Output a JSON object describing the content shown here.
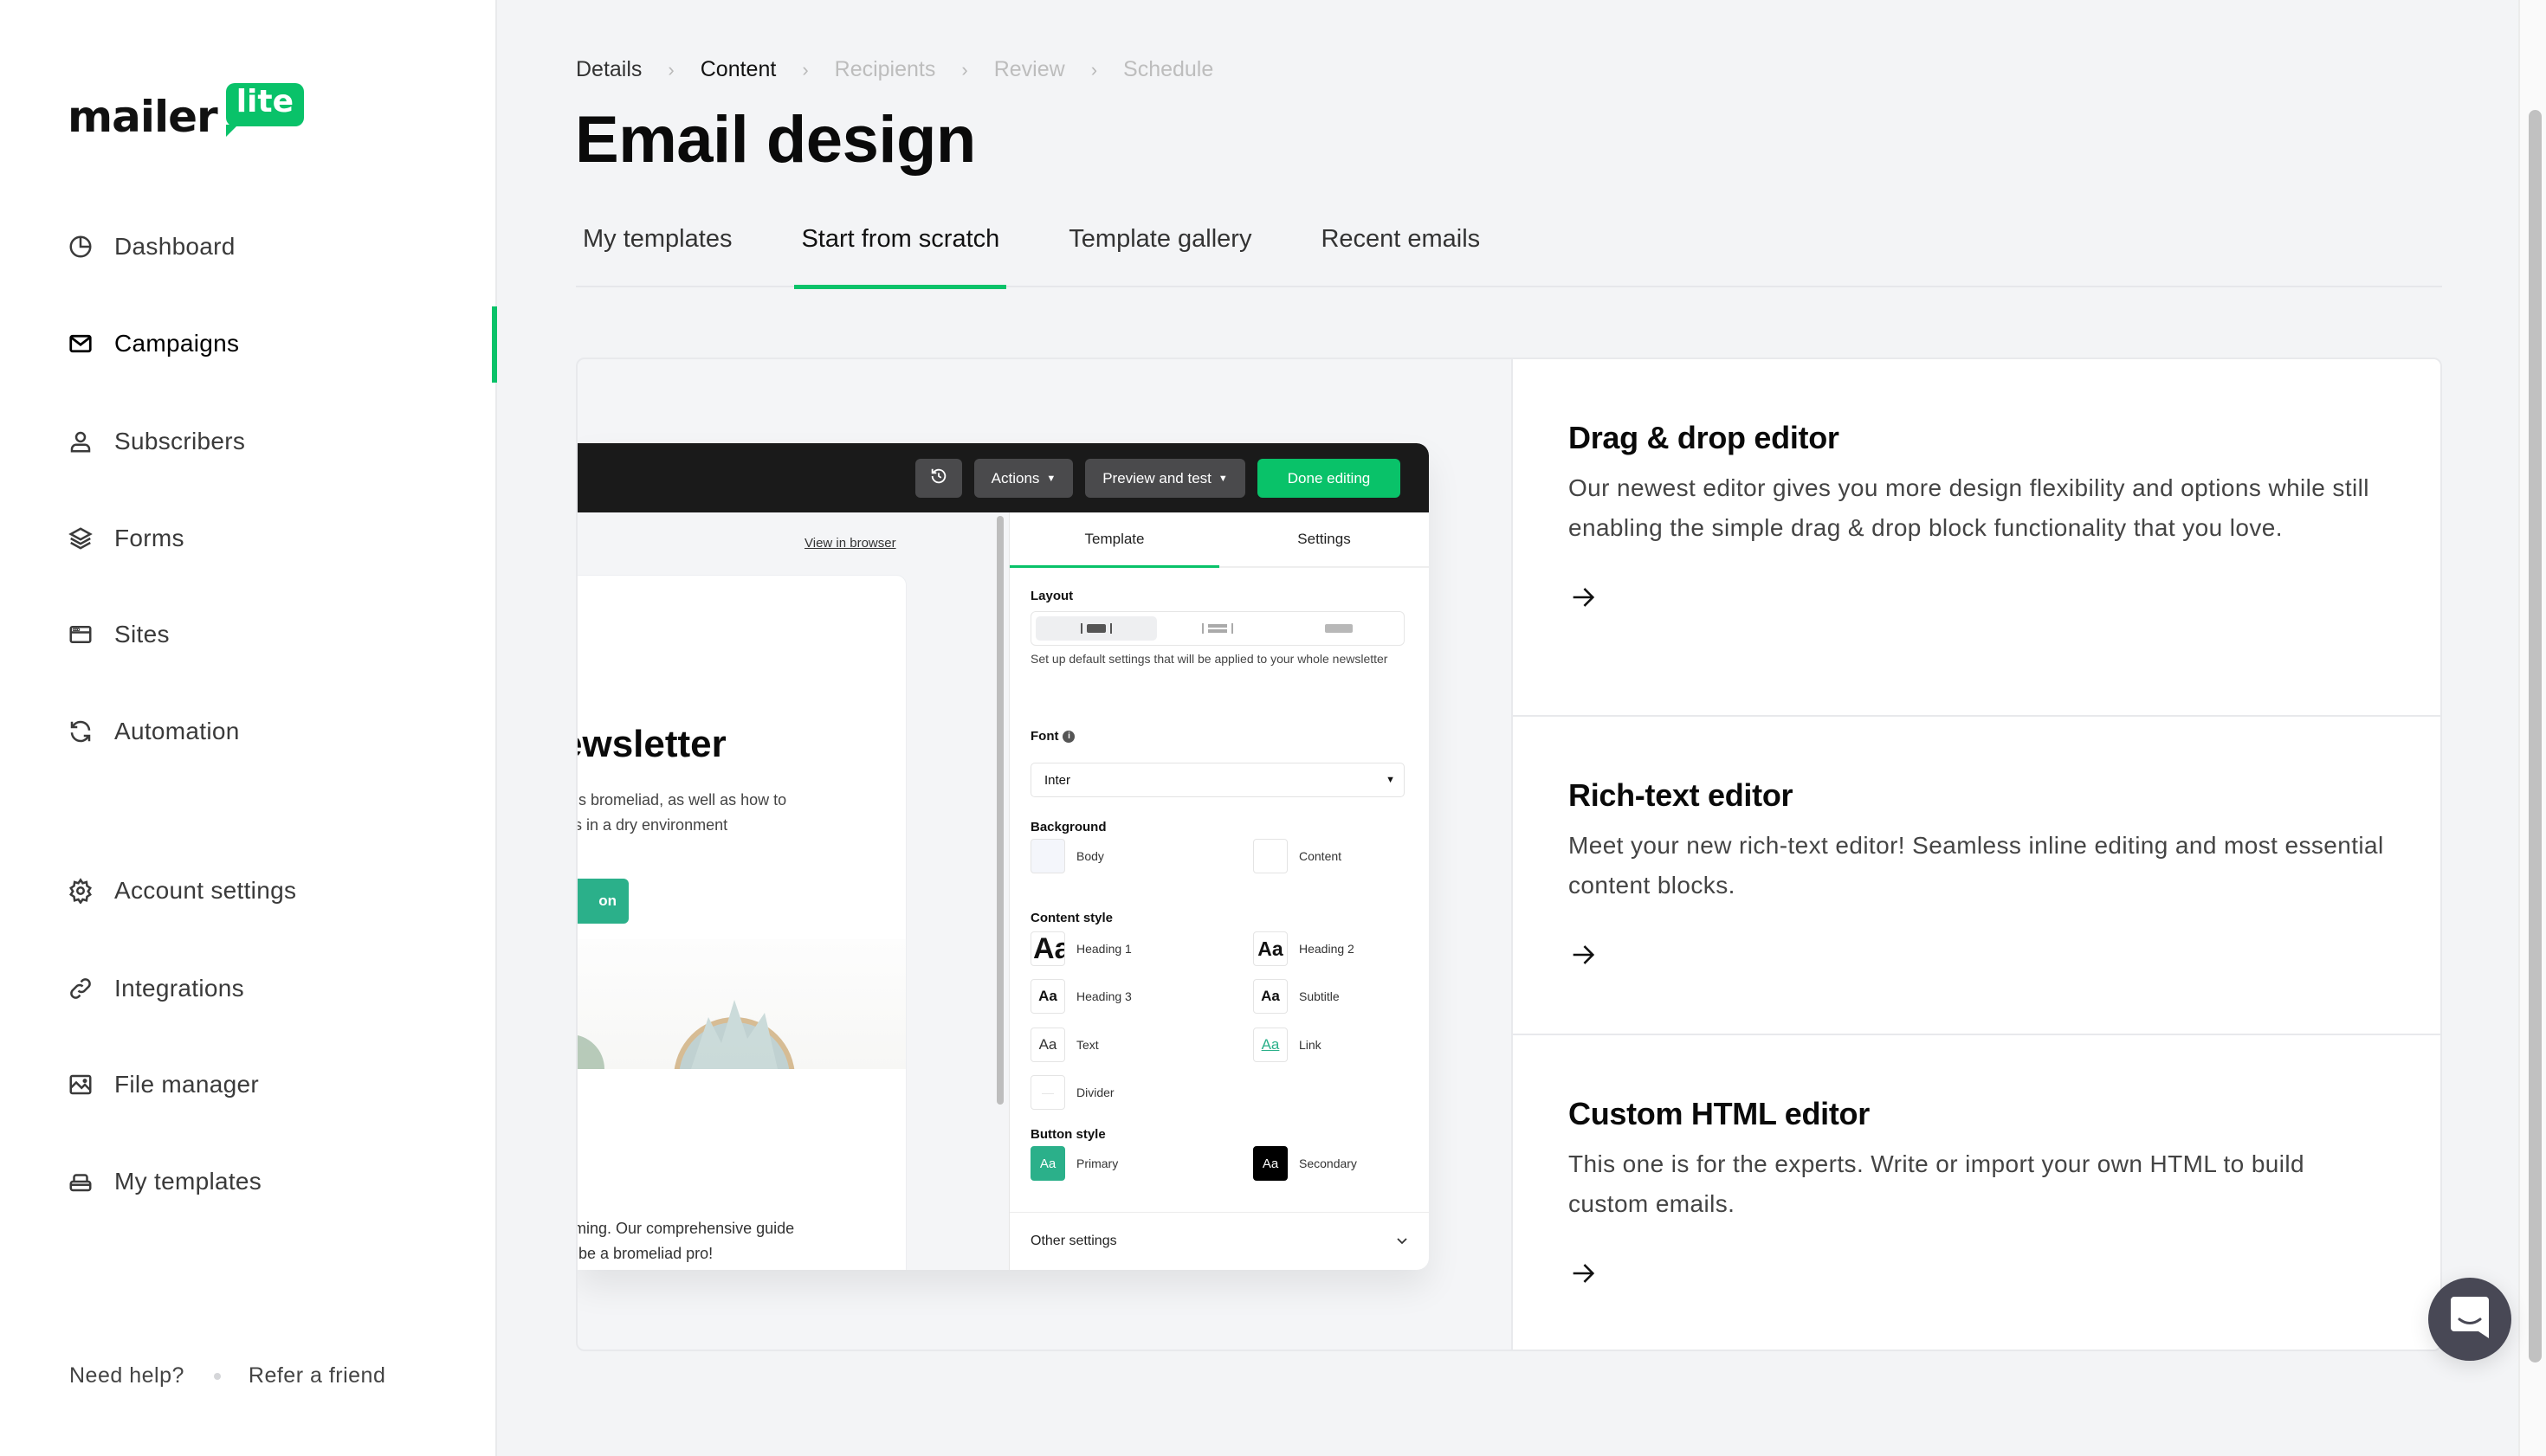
{
  "brand": {
    "name_part1": "mailer",
    "name_part2": "lite",
    "accent": "#09c269"
  },
  "sidebar": {
    "items": [
      {
        "label": "Dashboard",
        "icon": "pie-chart-icon",
        "active": false
      },
      {
        "label": "Campaigns",
        "icon": "envelope-icon",
        "active": true
      },
      {
        "label": "Subscribers",
        "icon": "user-icon",
        "active": false
      },
      {
        "label": "Forms",
        "icon": "layers-icon",
        "active": false
      },
      {
        "label": "Sites",
        "icon": "browser-window-icon",
        "active": false
      },
      {
        "label": "Automation",
        "icon": "refresh-icon",
        "active": false
      },
      {
        "label": "Account settings",
        "icon": "gear-icon",
        "active": false
      },
      {
        "label": "Integrations",
        "icon": "link-icon",
        "active": false
      },
      {
        "label": "File manager",
        "icon": "image-icon",
        "active": false
      },
      {
        "label": "My templates",
        "icon": "stack-icon",
        "active": false
      }
    ],
    "footer": {
      "help": "Need help?",
      "refer": "Refer a friend"
    }
  },
  "breadcrumb": [
    {
      "label": "Details",
      "state": "done"
    },
    {
      "label": "Content",
      "state": "current"
    },
    {
      "label": "Recipients",
      "state": "upcoming"
    },
    {
      "label": "Review",
      "state": "upcoming"
    },
    {
      "label": "Schedule",
      "state": "upcoming"
    }
  ],
  "page": {
    "title": "Email design"
  },
  "tabs": [
    {
      "label": "My templates",
      "active": false
    },
    {
      "label": "Start from scratch",
      "active": true
    },
    {
      "label": "Template gallery",
      "active": false
    },
    {
      "label": "Recent emails",
      "active": false
    }
  ],
  "editor_preview": {
    "toolbar": {
      "history_icon": "history-icon",
      "actions": "Actions",
      "preview": "Preview and test",
      "done": "Done editing"
    },
    "view_in_browser": "View in browser",
    "newsletter": {
      "title": "ewsletter",
      "subtitle": "ngs bromeliad, as well as how to\nnts in a dry environment",
      "button": "on",
      "body": "elming. Our comprehensive guide\nto be a bromeliad pro!"
    },
    "panel": {
      "tabs": [
        "Template",
        "Settings"
      ],
      "active_tab": "Template",
      "layout_label": "Layout",
      "help_text": "Set up default settings that will be applied to your whole newsletter",
      "font_label": "Font",
      "font_value": "Inter",
      "background_label": "Background",
      "backgrounds": [
        "Body",
        "Content"
      ],
      "content_style_label": "Content style",
      "content_styles": [
        {
          "sample": "Aa",
          "label": "Heading 1"
        },
        {
          "sample": "Aa",
          "label": "Heading 2"
        },
        {
          "sample": "Aa",
          "label": "Heading 3"
        },
        {
          "sample": "Aa",
          "label": "Subtitle"
        },
        {
          "sample": "Aa",
          "label": "Text"
        },
        {
          "sample": "Aa",
          "label": "Link"
        },
        {
          "sample": "—",
          "label": "Divider"
        }
      ],
      "button_style_label": "Button style",
      "button_styles": [
        {
          "sample": "Aa",
          "label": "Primary",
          "color": "#2bb08a"
        },
        {
          "sample": "Aa",
          "label": "Secondary",
          "color": "#000000"
        }
      ],
      "other_settings": "Other settings"
    }
  },
  "options": [
    {
      "title": "Drag & drop editor",
      "description": "Our newest editor gives you more design flexibility and options while still enabling the simple drag & drop block functionality that you love."
    },
    {
      "title": "Rich-text editor",
      "description": "Meet your new rich-text editor! Seamless inline editing and most essential content blocks."
    },
    {
      "title": "Custom HTML editor",
      "description": "This one is for the experts. Write or import your own HTML to build custom emails."
    }
  ]
}
